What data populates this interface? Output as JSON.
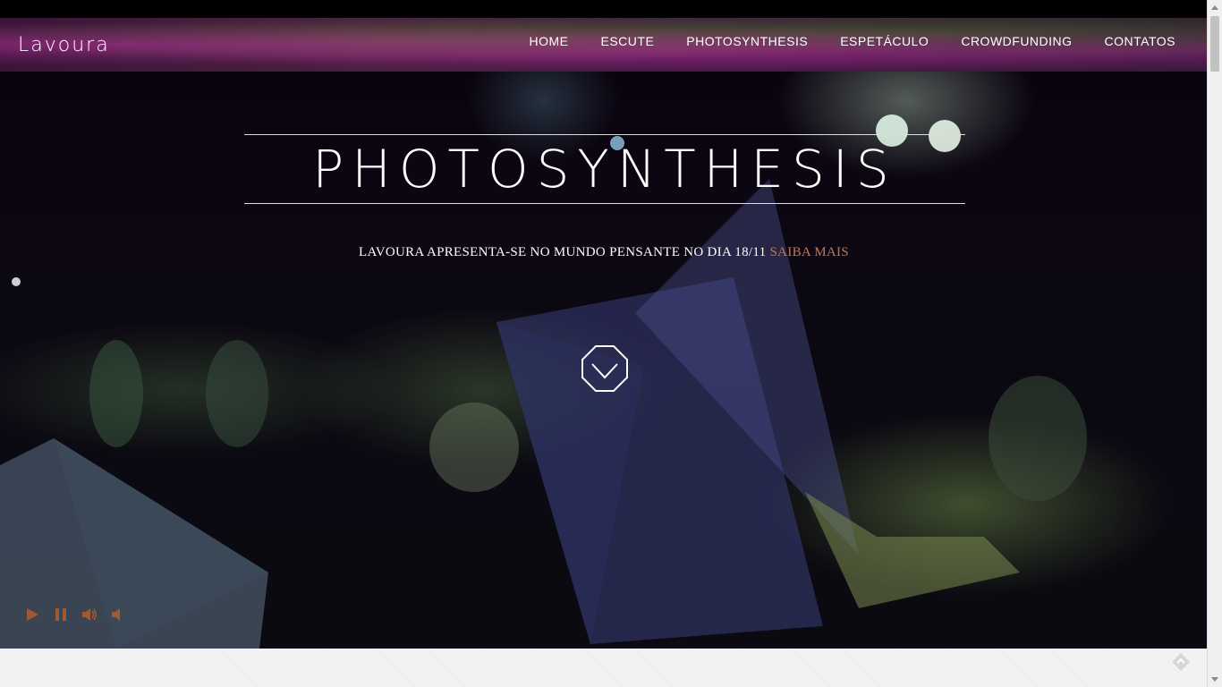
{
  "header": {
    "logo": "Lavoura",
    "nav": [
      {
        "label": "HOME"
      },
      {
        "label": "ESCUTE"
      },
      {
        "label": "PHOTOSYNTHESIS"
      },
      {
        "label": "ESPETÁCULO"
      },
      {
        "label": "CROWDFUNDING"
      },
      {
        "label": "CONTATOS"
      }
    ]
  },
  "hero": {
    "title": "PHOTOSYNTHESIS",
    "tagline": "LAVOURA APRESENTA-SE NO MUNDO PENSANTE NO DIA 18/11",
    "tagline_link": "SAIBA MAIS",
    "scroll_icon": "chevron-down-octagon-icon"
  },
  "player": {
    "icons": [
      "play-icon",
      "pause-icon",
      "volume-up-icon",
      "volume-mute-icon"
    ]
  },
  "colors": {
    "link": "#c0785a",
    "controls": "#a05a32"
  }
}
